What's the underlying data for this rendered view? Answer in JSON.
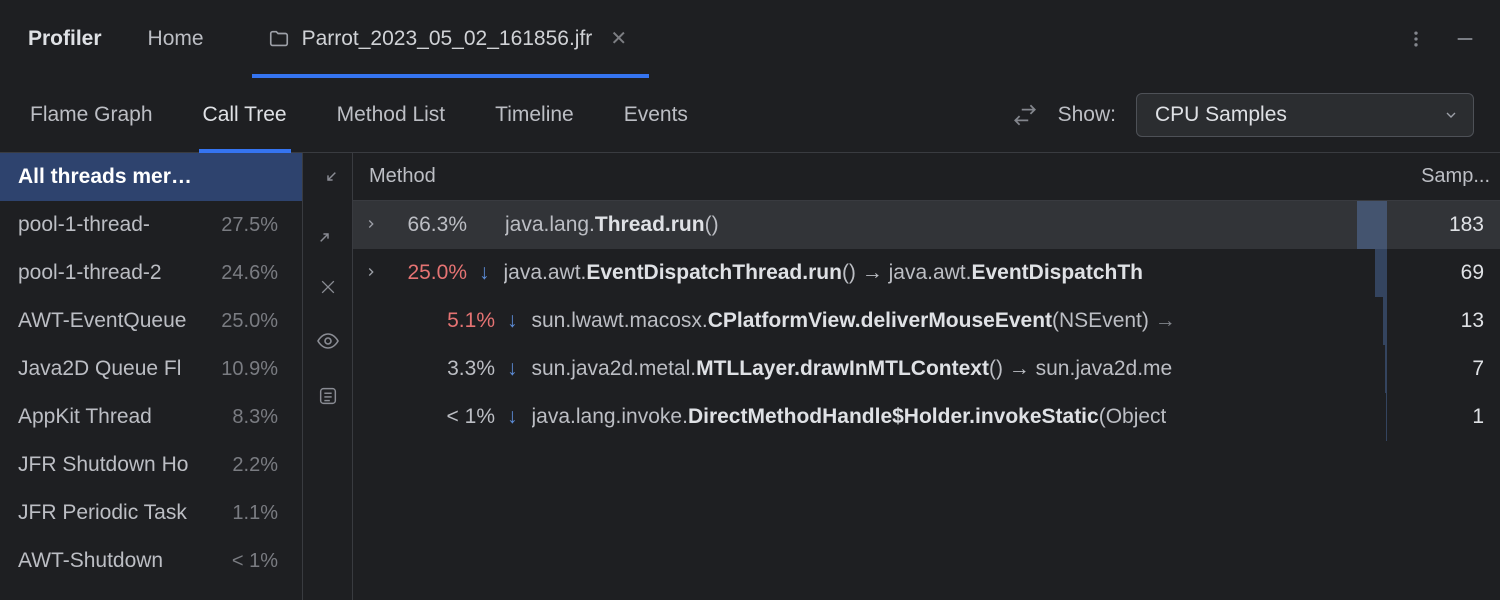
{
  "header": {
    "title": "Profiler",
    "home": "Home",
    "tab_name": "Parrot_2023_05_02_161856.jfr"
  },
  "view_tabs": [
    "Flame Graph",
    "Call Tree",
    "Method List",
    "Timeline",
    "Events"
  ],
  "active_view_tab": 1,
  "show_label": "Show:",
  "show_value": "CPU Samples",
  "sidebar": {
    "items": [
      {
        "name": "All threads merged",
        "pct": "",
        "selected": true
      },
      {
        "name": "pool-1-thread-",
        "pct": "27.5%"
      },
      {
        "name": "pool-1-thread-2",
        "pct": "24.6%"
      },
      {
        "name": "AWT-EventQueue",
        "pct": "25.0%"
      },
      {
        "name": "Java2D Queue Fl",
        "pct": "10.9%"
      },
      {
        "name": "AppKit Thread",
        "pct": "8.3%"
      },
      {
        "name": "JFR Shutdown Ho",
        "pct": "2.2%"
      },
      {
        "name": "JFR Periodic Task",
        "pct": "1.1%"
      },
      {
        "name": "AWT-Shutdown",
        "pct": "< 1%"
      }
    ]
  },
  "table": {
    "th_method": "Method",
    "th_samples": "Samp...",
    "rows": [
      {
        "expand": true,
        "expanded": false,
        "pct": "66.3%",
        "pct_red": false,
        "arrow": false,
        "indent": 0,
        "pkg": "java.lang.",
        "method": "Thread.run",
        "tail": "()",
        "samples": "183",
        "bar": 30,
        "selected": true
      },
      {
        "expand": true,
        "expanded": false,
        "pct": "25.0%",
        "pct_red": true,
        "arrow": true,
        "indent": 0,
        "pkg": "java.awt.",
        "method": "EventDispatchThread.run",
        "tail": "() → java.awt.<b>EventDispatchTh</b>",
        "samples": "69",
        "bar": 12
      },
      {
        "expand": false,
        "pct": "5.1%",
        "pct_red": true,
        "arrow": true,
        "indent": 1,
        "pkg": "sun.lwawt.macosx.",
        "method": "CPlatformView.deliverMouseEvent",
        "tail": "(NSEvent) <span class='dim'>→</span>",
        "samples": "13",
        "bar": 4
      },
      {
        "expand": false,
        "pct": "3.3%",
        "pct_red": false,
        "arrow": true,
        "indent": 1,
        "pkg": "sun.java2d.metal.",
        "method": "MTLLayer.drawInMTLContext",
        "tail": "() → sun.java2d.me",
        "samples": "7",
        "bar": 2
      },
      {
        "expand": false,
        "pct": "< 1%",
        "pct_red": false,
        "arrow": true,
        "indent": 1,
        "pkg": "java.lang.invoke.",
        "method": "DirectMethodHandle$Holder.invokeStatic",
        "tail": "(Object",
        "samples": "1",
        "bar": 1
      }
    ]
  }
}
